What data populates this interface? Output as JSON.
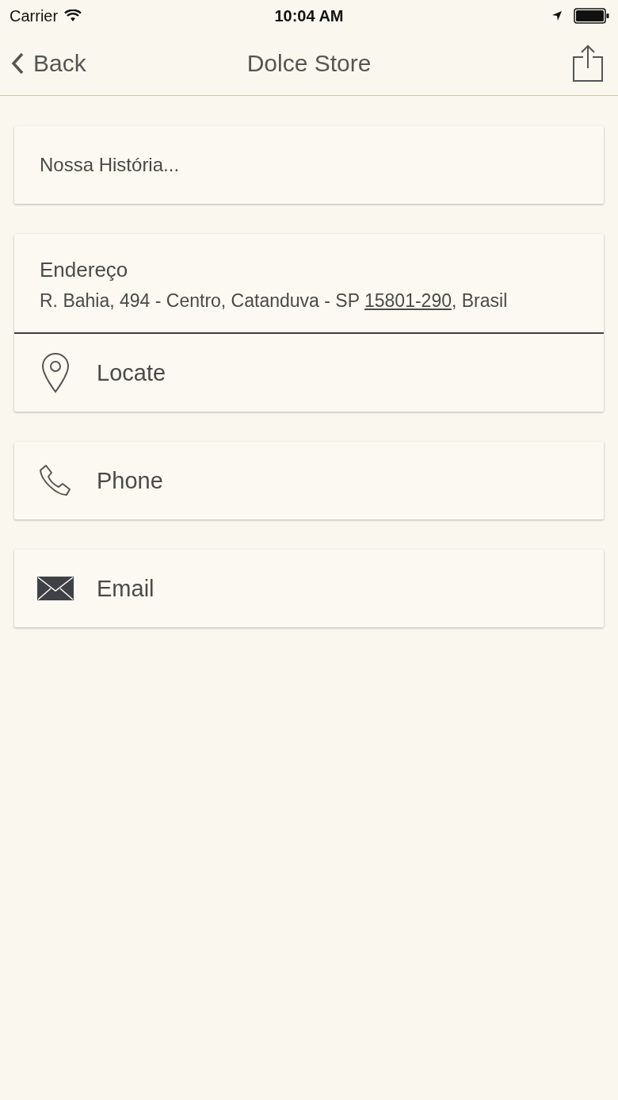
{
  "status_bar": {
    "carrier": "Carrier",
    "time": "10:04 AM"
  },
  "nav": {
    "back": "Back",
    "title": "Dolce Store"
  },
  "story": {
    "text": "Nossa História..."
  },
  "address": {
    "label": "Endereço",
    "text_before": "R. Bahia, 494 - Centro, Catanduva - SP ",
    "postcode": "15801-290",
    "text_after": ", Brasil",
    "actions": [
      {
        "kind": "locate",
        "label": "Locate"
      }
    ]
  },
  "actions": [
    {
      "kind": "phone",
      "label": "Phone"
    },
    {
      "kind": "email",
      "label": "Email"
    }
  ]
}
